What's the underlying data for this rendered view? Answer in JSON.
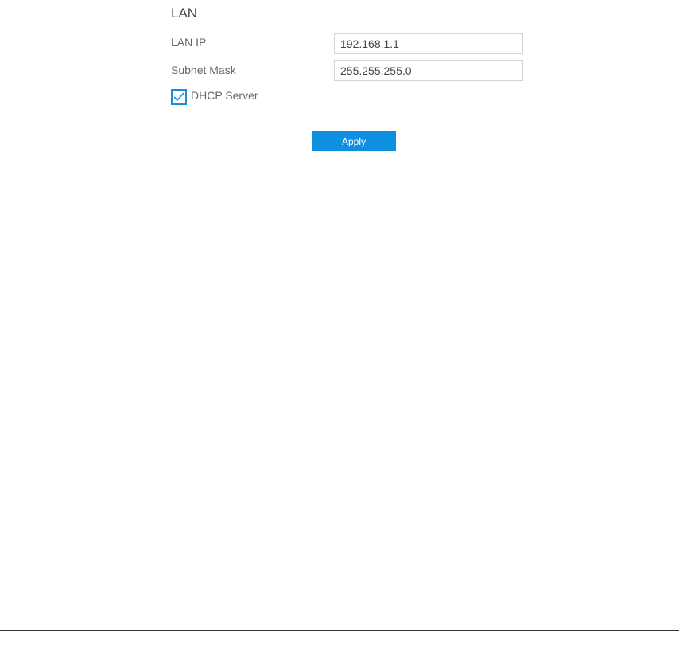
{
  "lan": {
    "title": "LAN",
    "lan_ip": {
      "label": "LAN IP",
      "value": "192.168.1.1"
    },
    "subnet_mask": {
      "label": "Subnet Mask",
      "value": "255.255.255.0"
    },
    "dhcp_server": {
      "label": "DHCP Server",
      "checked": true
    },
    "apply_label": "Apply"
  },
  "colors": {
    "accent": "#0f8fe0",
    "checkbox_border": "#1a8fd6"
  },
  "icons": {
    "checkbox": "check-icon"
  }
}
